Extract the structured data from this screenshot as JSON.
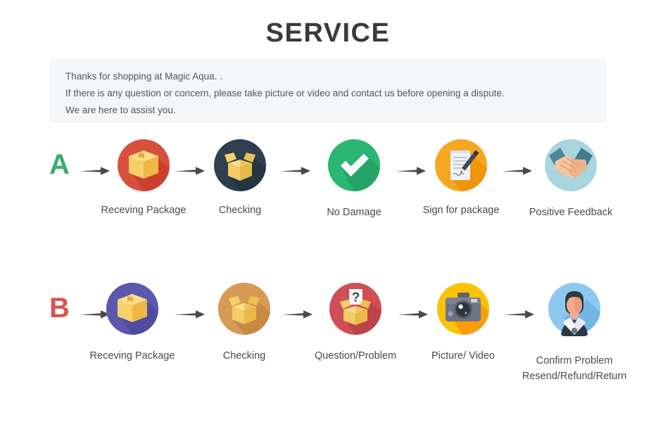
{
  "page": {
    "title": "SERVICE",
    "background": "#ffffff"
  },
  "notice": {
    "panel_color": "#f5f6f8",
    "lines": [
      "Thanks for shopping at Magic Aqua. .",
      "If there is any question or concern, please take picture or video and contact us before opening a dispute.",
      "We are here to assist you."
    ]
  },
  "flows": [
    {
      "id": "row-a",
      "letter": "A",
      "letter_color": "#3aad6e",
      "steps": [
        {
          "label": "Receving Package",
          "icon": "package-closed-icon",
          "circle_color": "#d94f3d"
        },
        {
          "label": "Checking",
          "icon": "package-open-icon",
          "circle_color": "#2e3f4f"
        },
        {
          "label": "No Damage",
          "icon": "check-mark-icon",
          "circle_color": "#2bb673"
        },
        {
          "label": "Sign for package",
          "icon": "document-pen-icon",
          "circle_color": "#f5a623"
        },
        {
          "label": "Positive Feedback",
          "icon": "handshake-icon",
          "circle_color": "#a8d5de"
        }
      ]
    },
    {
      "id": "row-b",
      "letter": "B",
      "letter_color": "#d9534f",
      "steps": [
        {
          "label": "Receving Package",
          "icon": "package-closed-icon",
          "circle_color": "#5b58b0"
        },
        {
          "label": "Checking",
          "icon": "package-open-icon",
          "circle_color": "#d79a54"
        },
        {
          "label": "Question/Problem",
          "icon": "package-question-icon",
          "circle_color": "#cf4f55"
        },
        {
          "label": "Picture/ Video",
          "icon": "camera-icon",
          "circle_color": "#fbc307"
        },
        {
          "label": "Confirm Problem\nResend/Refund/Return",
          "icon": "support-person-icon",
          "circle_color": "#8ec8f0"
        }
      ]
    }
  ],
  "arrow": {
    "icon": "arrow-right-icon",
    "color": "#4a4a4a"
  }
}
